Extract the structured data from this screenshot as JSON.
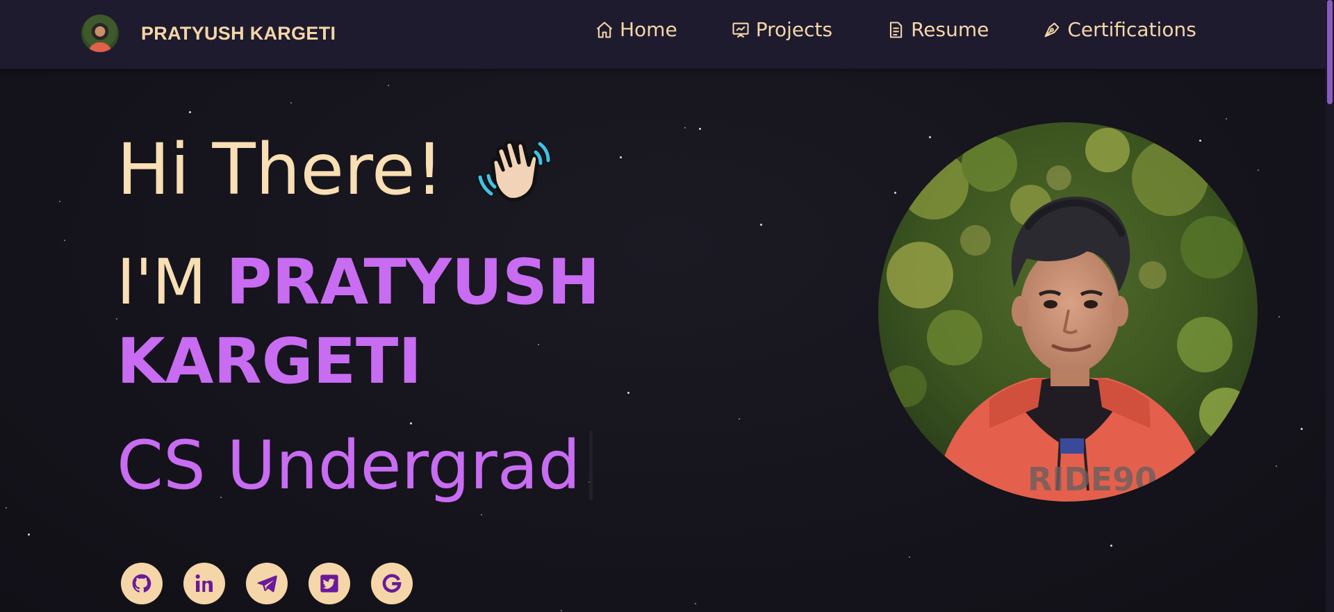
{
  "navbar": {
    "brand_name": "PRATYUSH KARGETI",
    "links": [
      {
        "label": "Home",
        "icon": "home-icon"
      },
      {
        "label": "Projects",
        "icon": "projects-icon"
      },
      {
        "label": "Resume",
        "icon": "resume-icon"
      },
      {
        "label": "Certifications",
        "icon": "pen-nib-icon"
      }
    ]
  },
  "hero": {
    "greeting": "Hi There!",
    "intro_prefix": "I'M ",
    "name": "PRATYUSH KARGETI",
    "role": "CS Undergrad"
  },
  "socials": [
    {
      "icon": "github-icon"
    },
    {
      "icon": "linkedin-icon"
    },
    {
      "icon": "telegram-icon"
    },
    {
      "icon": "twitter-icon"
    },
    {
      "icon": "google-icon"
    }
  ],
  "colors": {
    "accent": "#c86cf2",
    "text": "#f8dfb4",
    "navbar": "#1e1b2f",
    "background": "#16141d"
  }
}
